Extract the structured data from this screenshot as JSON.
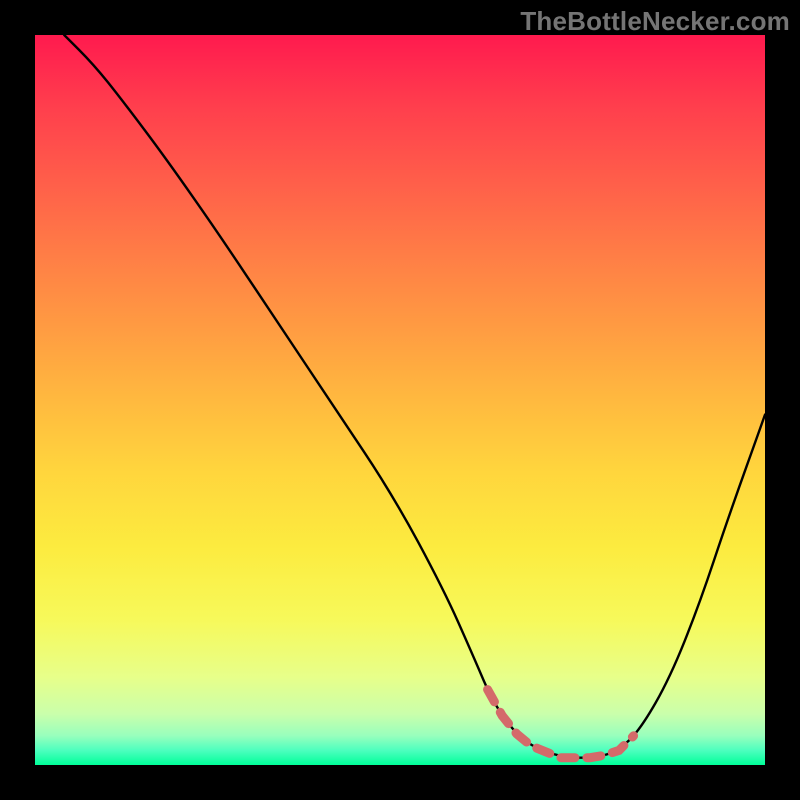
{
  "watermark": "TheBottleNecker.com",
  "chart_data": {
    "type": "line",
    "title": "",
    "xlabel": "",
    "ylabel": "",
    "xlim": [
      0,
      100
    ],
    "ylim": [
      0,
      100
    ],
    "series": [
      {
        "name": "curve",
        "x": [
          4,
          8,
          12,
          18,
          25,
          33,
          41,
          49,
          56,
          60,
          63,
          67,
          72,
          77,
          80,
          83,
          87,
          91,
          95,
          100
        ],
        "y": [
          100,
          96,
          91,
          83,
          73,
          61,
          49,
          37,
          24,
          15,
          8,
          3,
          1,
          1,
          2,
          5,
          12,
          22,
          34,
          48
        ]
      }
    ],
    "flat_highlight": {
      "x_start": 62,
      "x_end": 83,
      "color": "#d46a6a"
    },
    "gradient_stops": [
      {
        "pos": 0,
        "hex": "#ff1a4e"
      },
      {
        "pos": 10,
        "hex": "#ff3f4d"
      },
      {
        "pos": 20,
        "hex": "#ff5e4a"
      },
      {
        "pos": 30,
        "hex": "#ff7d46"
      },
      {
        "pos": 40,
        "hex": "#ff9b42"
      },
      {
        "pos": 50,
        "hex": "#ffb93f"
      },
      {
        "pos": 60,
        "hex": "#ffd63d"
      },
      {
        "pos": 70,
        "hex": "#fceb3f"
      },
      {
        "pos": 80,
        "hex": "#f7f95a"
      },
      {
        "pos": 88,
        "hex": "#e7ff8a"
      },
      {
        "pos": 93,
        "hex": "#caffab"
      },
      {
        "pos": 96,
        "hex": "#98ffbd"
      },
      {
        "pos": 98,
        "hex": "#4dffbe"
      },
      {
        "pos": 100,
        "hex": "#00ff99"
      }
    ]
  }
}
